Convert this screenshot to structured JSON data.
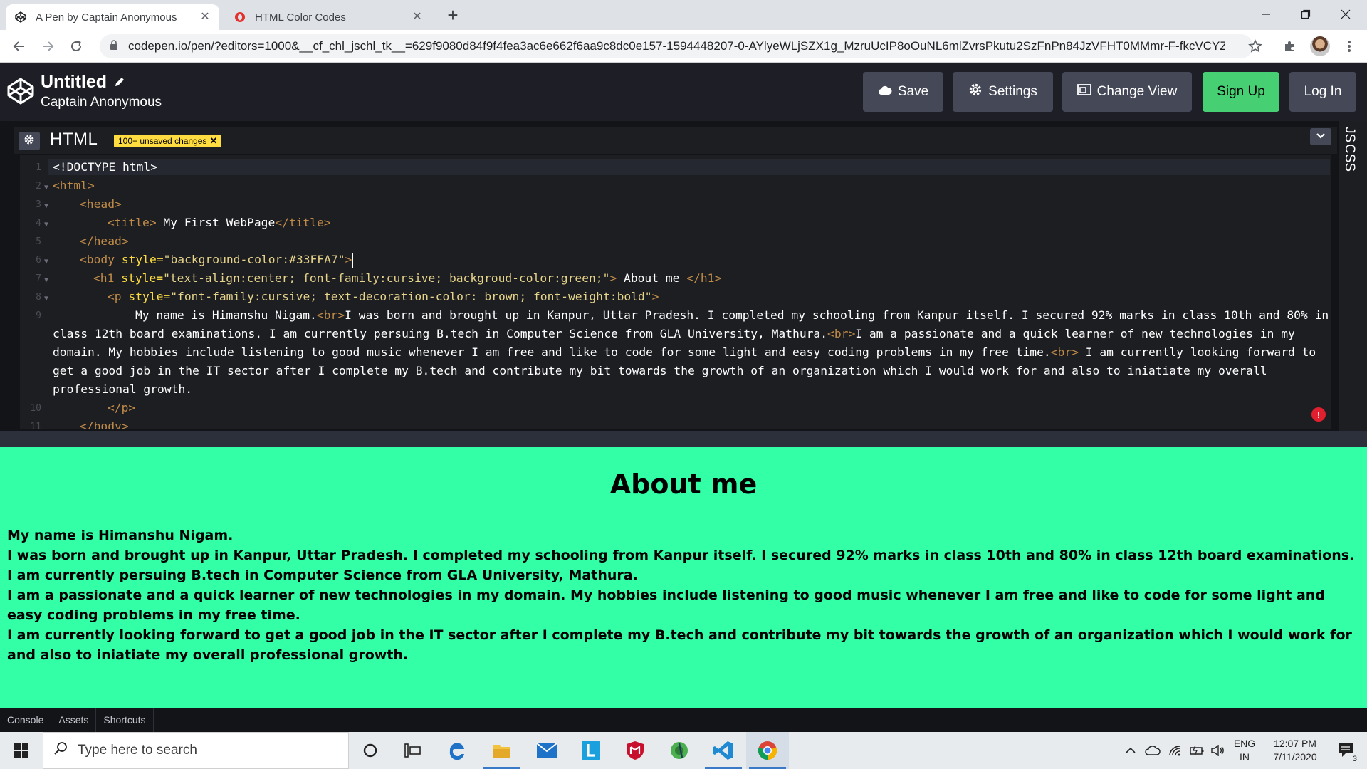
{
  "browser": {
    "tabs": [
      {
        "title": "A Pen by Captain Anonymous",
        "active": true
      },
      {
        "title": "HTML Color Codes",
        "active": false
      }
    ],
    "url": "codepen.io/pen/?editors=1000&__cf_chl_jschl_tk__=629f9080d84f9f4fea3ac6e662f6aa9c8dc0e157-1594448207-0-AYlyeWLjSZX1g_MzruUcIP8oOuNL6mlZvrsPkutu2SzFnPn84JzVFHT0MMmr-F-fkcVCYZv..."
  },
  "header": {
    "title": "Untitled",
    "author": "Captain Anonymous",
    "save_label": "Save",
    "settings_label": "Settings",
    "change_view_label": "Change View",
    "signup_label": "Sign Up",
    "login_label": "Log In"
  },
  "editor": {
    "language": "HTML",
    "unsaved_badge": "100+ unsaved changes",
    "side_tabs": [
      "CSS",
      "JS"
    ],
    "lines": {
      "l1": "<!DOCTYPE html>",
      "l2": "<html>",
      "l3": "<head>",
      "l4_open": "<title>",
      "l4_text": " My First WebPage",
      "l4_close": "</title>",
      "l5": "</head>",
      "l6_tag": "<body",
      "l6_attr": "style=",
      "l6_val": "\"background-color:#33FFA7\"",
      "l6_end": ">",
      "l7_tag": "<h1",
      "l7_attr": "style=",
      "l7_val": "\"text-align:center; font-family:cursive; backgroud-color:green;\"",
      "l7_end": ">",
      "l7_text": " About me ",
      "l7_close": "</h1>",
      "l8_tag": "<p",
      "l8_attr": "style=",
      "l8_val": "\"font-family:cursive; text-decoration-color: brown; font-weight:bold\"",
      "l8_end": ">",
      "l9_a": "My name is Himanshu Nigam.",
      "l9_b": "I was born and brought up in Kanpur, Uttar Pradesh. I completed my schooling from Kanpur itself. I secured 92% marks in class 10th and 80% in class 12th board examinations. I am currently persuing B.tech in Computer Science from GLA University, Mathura.",
      "l9_c": "I am a passionate and a quick learner of new technologies in my domain. My hobbies include listening to good music whenever I am free and like to code for some light and easy coding problems in my free time.",
      "l9_d": " I am currently looking forward to get a good job in the IT sector after I complete my B.tech and contribute my bit towards the growth of an organization which I would work for and also to iniatiate my overall professional growth.",
      "br": "<br>",
      "l10": "</p>",
      "l11": "</body>"
    },
    "line_numbers": [
      "1",
      "2",
      "3",
      "4",
      "5",
      "6",
      "7",
      "8",
      "9",
      "10",
      "11"
    ]
  },
  "preview": {
    "heading": "About me",
    "para": [
      "My name is Himanshu Nigam.",
      "I was born and brought up in Kanpur, Uttar Pradesh. I completed my schooling from Kanpur itself. I secured 92% marks in class 10th and 80% in class 12th board examinations. I am currently persuing B.tech in Computer Science from GLA University, Mathura.",
      "I am a passionate and a quick learner of new technologies in my domain. My hobbies include listening to good music whenever I am free and like to code for some light and easy coding problems in my free time.",
      "I am currently looking forward to get a good job in the IT sector after I complete my B.tech and contribute my bit towards the growth of an organization which I would work for and also to iniatiate my overall professional growth."
    ],
    "background": "#33FFA7"
  },
  "footer": {
    "console_label": "Console",
    "assets_label": "Assets",
    "shortcuts_label": "Shortcuts"
  },
  "taskbar": {
    "search_placeholder": "Type here to search",
    "lang_top": "ENG",
    "lang_bottom": "IN",
    "time": "12:07 PM",
    "date": "7/11/2020",
    "notification_count": "3"
  }
}
